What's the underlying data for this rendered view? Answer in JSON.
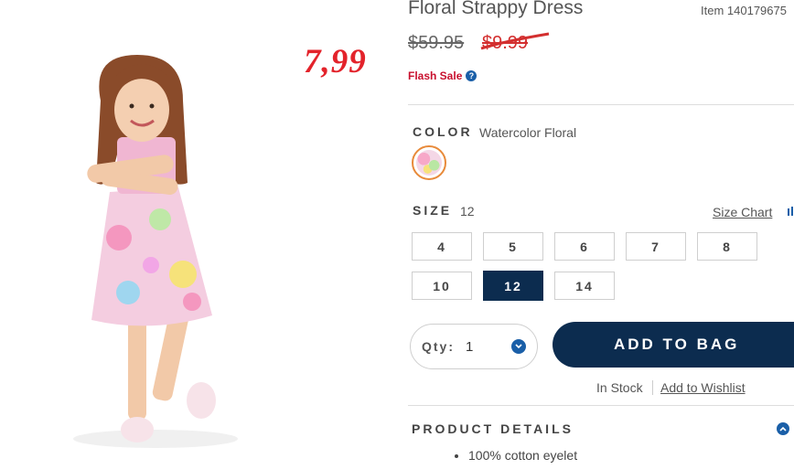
{
  "product": {
    "title": "Floral Strappy Dress",
    "item_number": "Item 140179675",
    "annotation_price": "7,99",
    "original_price": "$59.95",
    "sale_price": "$9.99",
    "flash_sale": "Flash Sale"
  },
  "color": {
    "label": "COLOR",
    "value": "Watercolor Floral"
  },
  "size": {
    "label": "SIZE",
    "value": "12",
    "chart_link": "Size Chart",
    "options": [
      "4",
      "5",
      "6",
      "7",
      "8",
      "10",
      "12",
      "14"
    ],
    "selected": "12"
  },
  "purchase": {
    "qty_label": "Qty:",
    "qty_value": "1",
    "add_to_bag": "ADD TO BAG",
    "stock": "In Stock",
    "wishlist": "Add to Wishlist"
  },
  "details": {
    "label": "PRODUCT DETAILS",
    "items": [
      "100% cotton eyelet"
    ]
  },
  "colors": {
    "navy": "#0c2c4f",
    "accent_blue": "#1a5fa8",
    "flash_red": "#c8102e",
    "annotation_red": "#e3232b"
  }
}
